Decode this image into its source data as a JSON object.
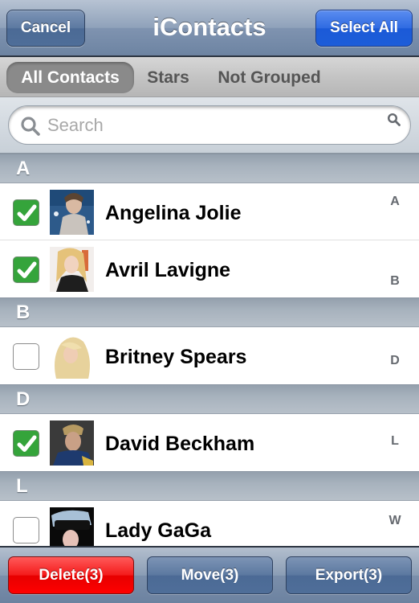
{
  "navbar": {
    "title": "iContacts",
    "cancel_label": "Cancel",
    "select_all_label": "Select All"
  },
  "tabs": [
    {
      "label": "All Contacts",
      "active": true
    },
    {
      "label": "Stars",
      "active": false
    },
    {
      "label": "Not Grouped",
      "active": false
    }
  ],
  "search": {
    "placeholder": "Search",
    "value": ""
  },
  "sections": [
    {
      "letter": "A",
      "contacts": [
        {
          "name": "Angelina Jolie",
          "checked": true,
          "avatar": "photo-angelina-jolie"
        },
        {
          "name": "Avril Lavigne",
          "checked": true,
          "avatar": "photo-avril-lavigne"
        }
      ]
    },
    {
      "letter": "B",
      "contacts": [
        {
          "name": "Britney Spears",
          "checked": false,
          "avatar": "photo-britney-spears"
        }
      ]
    },
    {
      "letter": "D",
      "contacts": [
        {
          "name": "David Beckham",
          "checked": true,
          "avatar": "photo-david-beckham"
        }
      ]
    },
    {
      "letter": "L",
      "contacts": [
        {
          "name": "Lady GaGa",
          "checked": false,
          "avatar": "photo-lady-gaga"
        }
      ]
    }
  ],
  "index": {
    "search_icon": "search-icon",
    "letters": [
      "A",
      "B",
      "D",
      "L",
      "W"
    ]
  },
  "toolbar": {
    "delete_label": "Delete(3)",
    "move_label": "Move(3)",
    "export_label": "Export(3)"
  },
  "colors": {
    "checkbox_checked": "#35a43b",
    "delete_red": "#ff0000",
    "select_all_blue": "#1d5dd9",
    "nav_blue": "#6d84a2"
  }
}
